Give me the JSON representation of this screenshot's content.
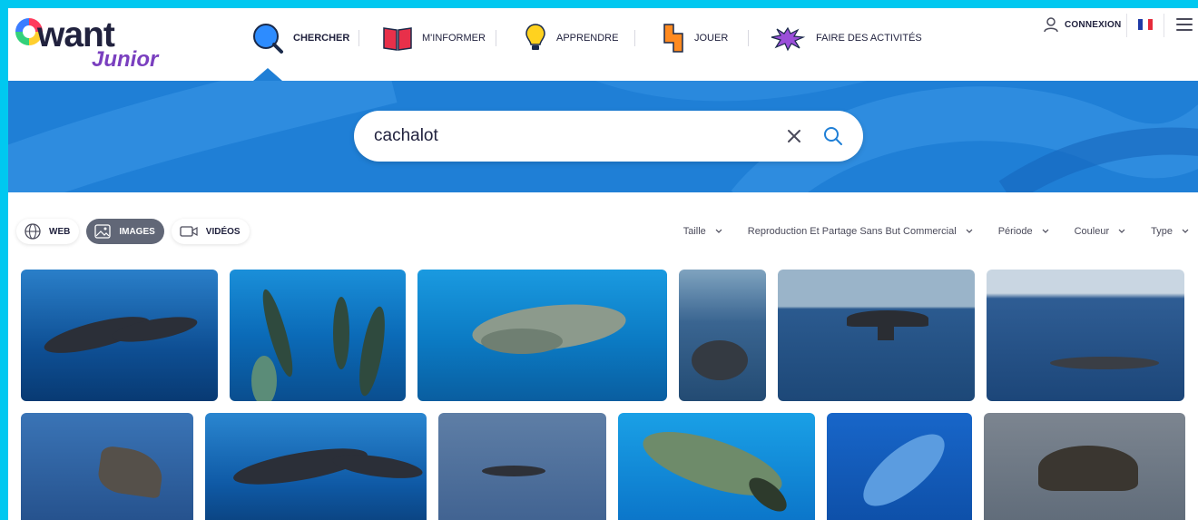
{
  "brand": {
    "logo_main": "want",
    "logo_sub": "Junior"
  },
  "nav": {
    "items": [
      {
        "label": "CHERCHER",
        "icon": "magnifier-icon",
        "active": true
      },
      {
        "label": "M'INFORMER",
        "icon": "book-icon",
        "active": false
      },
      {
        "label": "APPRENDRE",
        "icon": "lightbulb-icon",
        "active": false
      },
      {
        "label": "JOUER",
        "icon": "puzzle-icon",
        "active": false
      },
      {
        "label": "FAIRE DES ACTIVITÉS",
        "icon": "paint-splash-icon",
        "active": false
      }
    ],
    "login_label": "CONNEXION",
    "language": "FR",
    "colors": {
      "active_indicator": "#1f7fd6"
    }
  },
  "search": {
    "value": "cachalot",
    "placeholder": ""
  },
  "tabs": [
    {
      "label": "WEB",
      "icon": "globe-icon",
      "active": false
    },
    {
      "label": "IMAGES",
      "icon": "image-icon",
      "active": true
    },
    {
      "label": "VIDÉOS",
      "icon": "video-icon",
      "active": false
    }
  ],
  "filters": [
    {
      "label": "Taille"
    },
    {
      "label": "Reproduction Et Partage Sans But Commercial"
    },
    {
      "label": "Période"
    },
    {
      "label": "Couleur"
    },
    {
      "label": "Type"
    }
  ],
  "images": {
    "count_visible": 12,
    "subject": "cachalot"
  },
  "colors": {
    "page_border": "#00c8f0",
    "hero_blue": "#1f7fd6",
    "text_dark": "#21223e",
    "tab_active": "#616777"
  }
}
